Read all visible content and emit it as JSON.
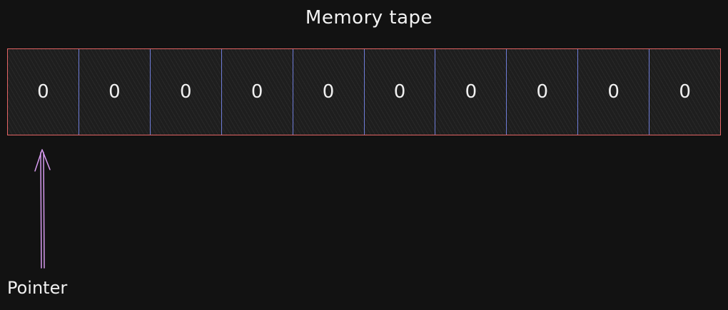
{
  "diagram": {
    "title": "Memory tape",
    "cells": [
      "0",
      "0",
      "0",
      "0",
      "0",
      "0",
      "0",
      "0",
      "0",
      "0"
    ],
    "pointer": {
      "label": "Pointer",
      "index": 0
    }
  },
  "colors": {
    "background": "#121212",
    "tape_border": "#e46464",
    "cell_divider": "#6f7dd8",
    "pointer_arrow": "#d79bf0",
    "text": "#f0f0f0"
  }
}
